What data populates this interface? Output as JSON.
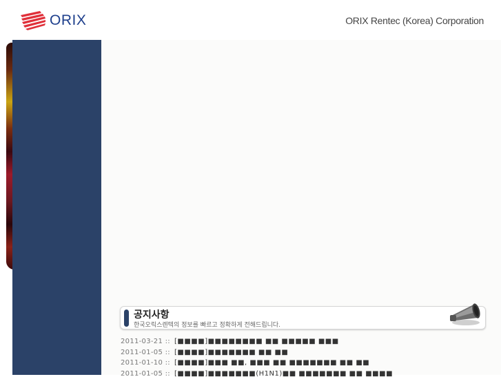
{
  "header": {
    "logo_text": "ORIX",
    "company": "ORIX Rentec (Korea) Corporation"
  },
  "notice": {
    "title": "공지사항",
    "subtitle": "한국오릭스렌텍의 정보를 빠르고 정확하게 전해드립니다."
  },
  "news": [
    {
      "date": "2011-03-21 ::",
      "title": "[■■■■]■■■■■■■■ ■■ ■■■■■ ■■■"
    },
    {
      "date": "2011-01-05 ::",
      "title": "[■■■■]■■■■■■■ ■■ ■■"
    },
    {
      "date": "2011-01-10 ::",
      "title": "[■■■■]■■■ ■■, ■■■ ■■ ■■■■■■■ ■■ ■■"
    },
    {
      "date": "2011-01-05 ::",
      "title": "[■■■■]■■■■■■■(H1N1)■■ ■■■■■■■ ■■ ■■■■"
    }
  ]
}
